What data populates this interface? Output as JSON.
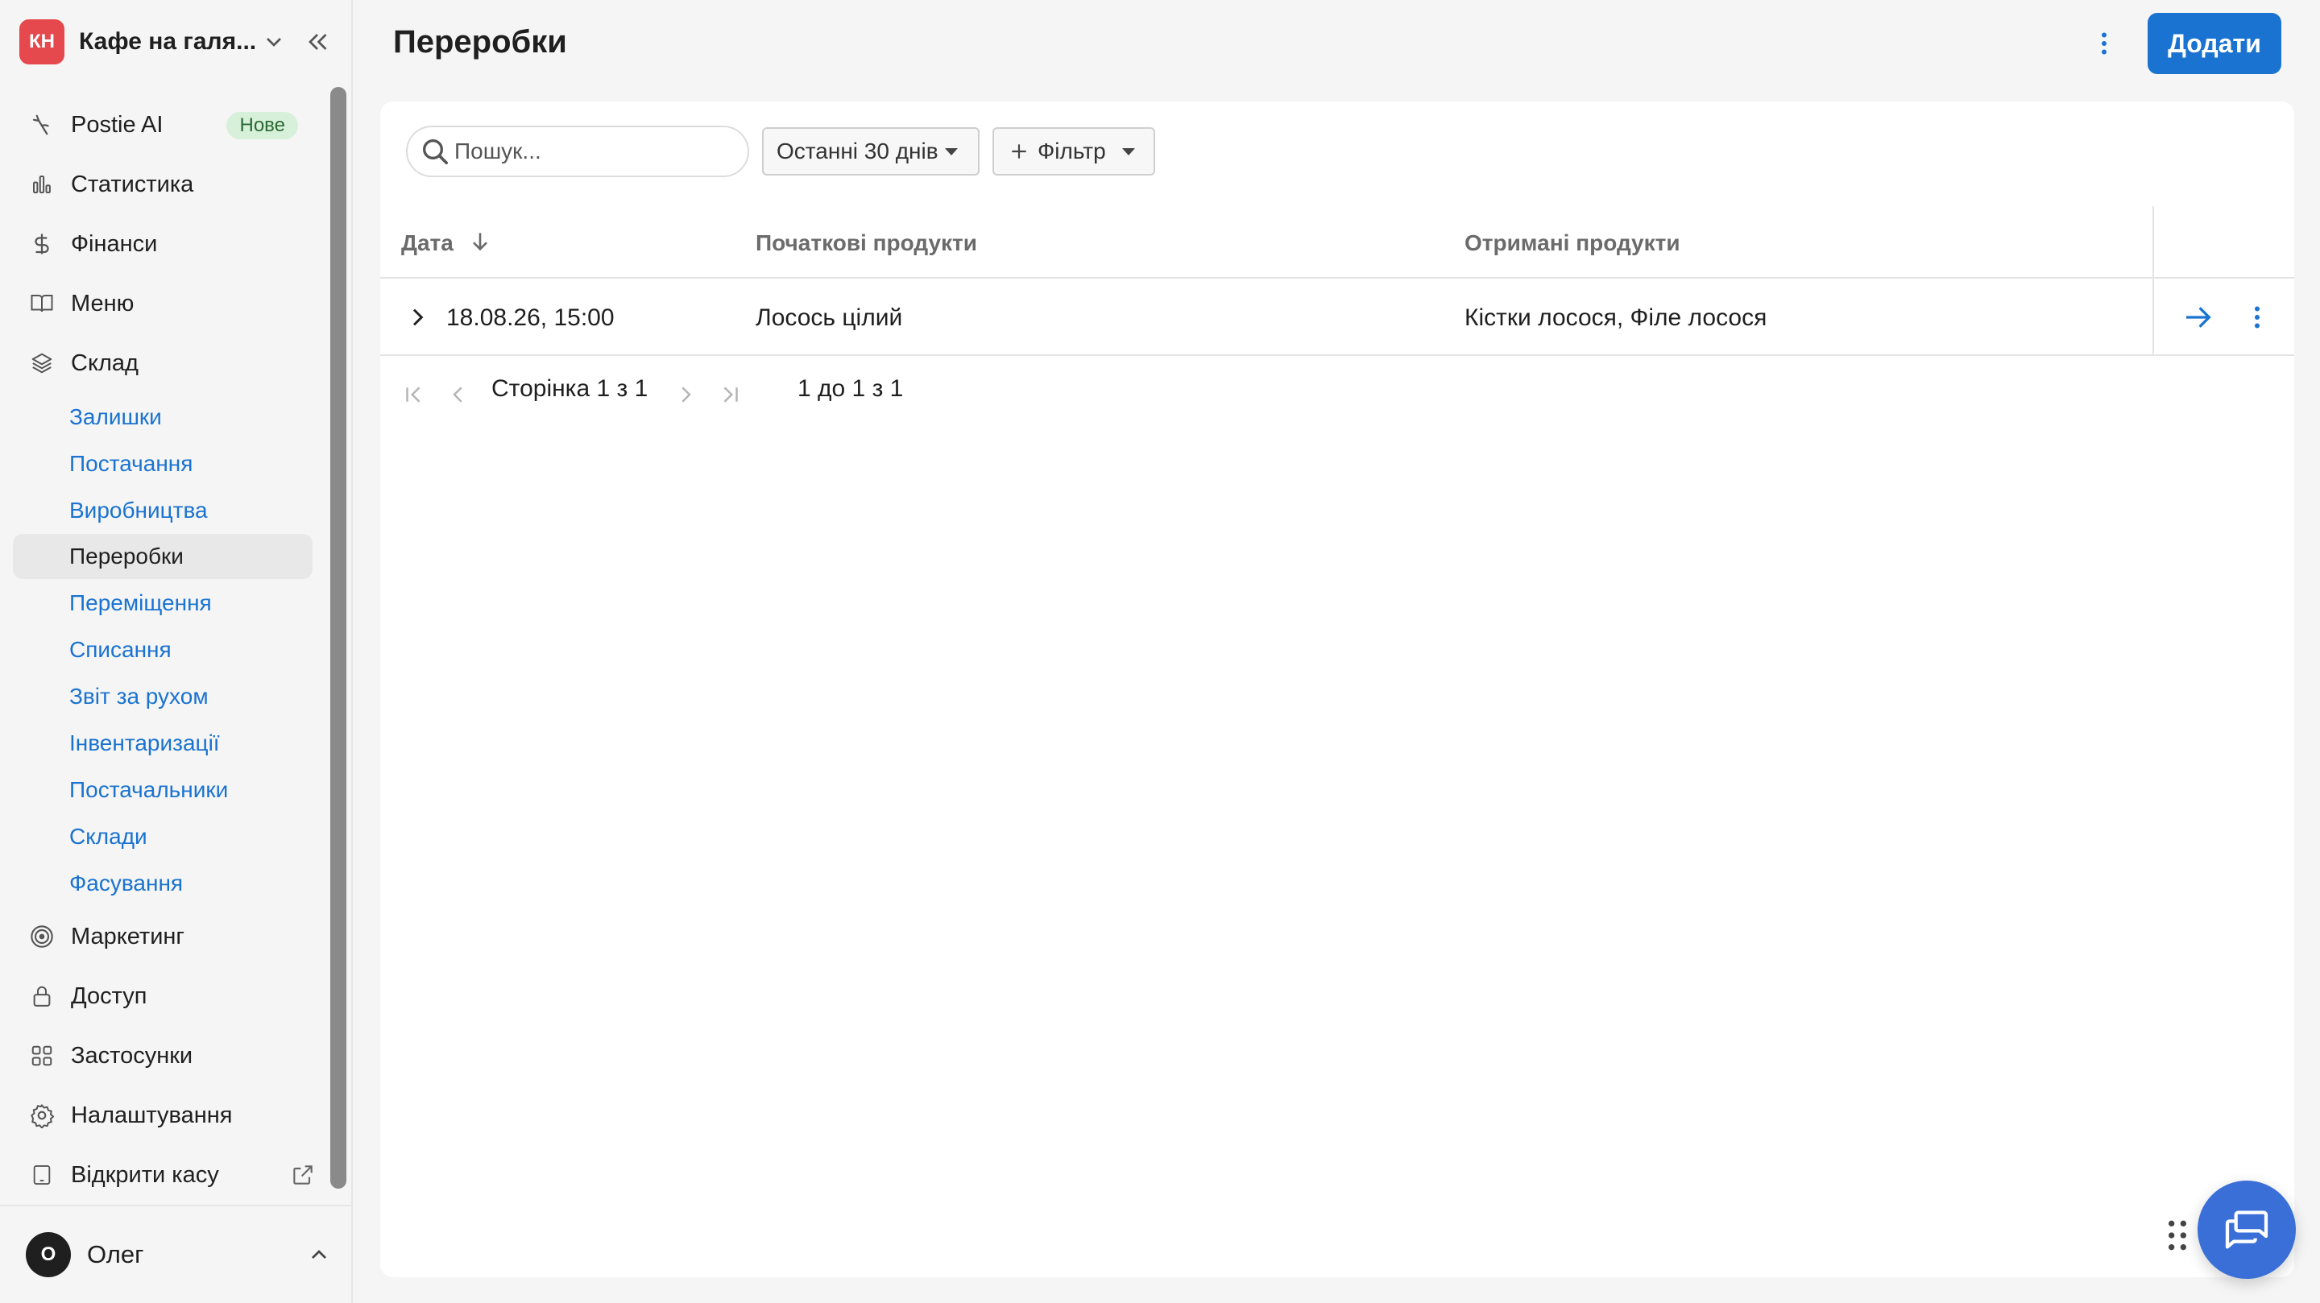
{
  "brand": {
    "initials": "КН",
    "name": "Кафе на галя..."
  },
  "nav": {
    "postie": {
      "label": "Postie AI",
      "badge": "Нове"
    },
    "stats": {
      "label": "Статистика"
    },
    "finance": {
      "label": "Фінанси"
    },
    "menu": {
      "label": "Меню"
    },
    "warehouse": {
      "label": "Склад"
    },
    "warehouse_items": [
      {
        "label": "Залишки"
      },
      {
        "label": "Постачання"
      },
      {
        "label": "Виробництва"
      },
      {
        "label": "Переробки"
      },
      {
        "label": "Переміщення"
      },
      {
        "label": "Списання"
      },
      {
        "label": "Звіт за рухом"
      },
      {
        "label": "Інвентаризації"
      },
      {
        "label": "Постачальники"
      },
      {
        "label": "Склади"
      },
      {
        "label": "Фасування"
      }
    ],
    "marketing": {
      "label": "Маркетинг"
    },
    "access": {
      "label": "Доступ"
    },
    "apps": {
      "label": "Застосунки"
    },
    "settings": {
      "label": "Налаштування"
    },
    "open_register": {
      "label": "Відкрити касу"
    }
  },
  "user": {
    "initial": "O",
    "name": "Олег"
  },
  "header": {
    "title": "Переробки",
    "add_label": "Додати"
  },
  "filters": {
    "search_placeholder": "Пошук...",
    "period": "Останні 30 днів",
    "add_filter": "Фільтр"
  },
  "table": {
    "columns": {
      "date": "Дата",
      "source": "Початкові продукти",
      "result": "Отримані продукти"
    },
    "rows": [
      {
        "date": "18.08.26, 15:00",
        "source": "Лосось цілий",
        "result": "Кістки лосося, Філе лосося"
      }
    ]
  },
  "pagination": {
    "page_text": "Сторінка 1 з 1",
    "range_text": "1 до 1 з 1"
  },
  "colors": {
    "accent": "#1a73d0",
    "brand": "#e5484d",
    "badge_bg": "#d6f0d9",
    "chat": "#3a6fd8"
  }
}
